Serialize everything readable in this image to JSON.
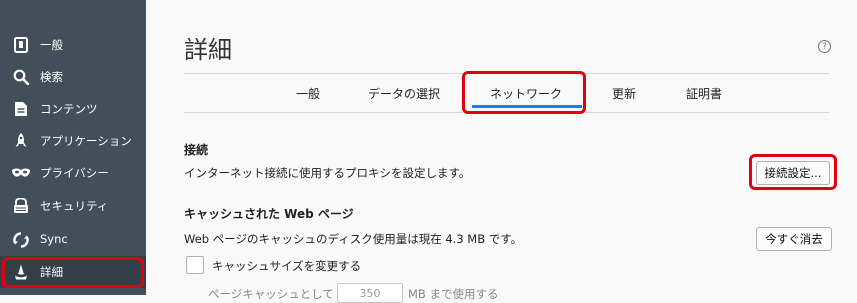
{
  "sidebar": {
    "items": [
      {
        "label": "一般",
        "icon": "general-icon"
      },
      {
        "label": "検索",
        "icon": "search-icon"
      },
      {
        "label": "コンテンツ",
        "icon": "content-icon"
      },
      {
        "label": "アプリケーション",
        "icon": "applications-icon"
      },
      {
        "label": "プライバシー",
        "icon": "privacy-mask-icon"
      },
      {
        "label": "セキュリティ",
        "icon": "security-icon"
      },
      {
        "label": "Sync",
        "icon": "sync-icon"
      },
      {
        "label": "詳細",
        "icon": "advanced-icon",
        "selected": true
      }
    ]
  },
  "page": {
    "title": "詳細",
    "help_icon": "?"
  },
  "tabs": [
    {
      "label": "一般"
    },
    {
      "label": "データの選択"
    },
    {
      "label": "ネットワーク",
      "active": true
    },
    {
      "label": "更新"
    },
    {
      "label": "証明書"
    }
  ],
  "connection": {
    "heading": "接続",
    "description": "インターネット接続に使用するプロキシを設定します。",
    "button": "接続設定..."
  },
  "cache": {
    "heading": "キャッシュされた Web ページ",
    "description": "Web ページのキャッシュのディスク使用量は現在 4.3 MB です。",
    "button": "今すぐ消去",
    "override_label": "キャッシュサイズを変更する",
    "limit_prefix": "ページキャッシュとして",
    "limit_value": "350",
    "limit_suffix": "MB まで使用する"
  },
  "colors": {
    "sidebar": "#424f5a",
    "accent": "#0a84ff",
    "highlight": "#e0000f"
  }
}
